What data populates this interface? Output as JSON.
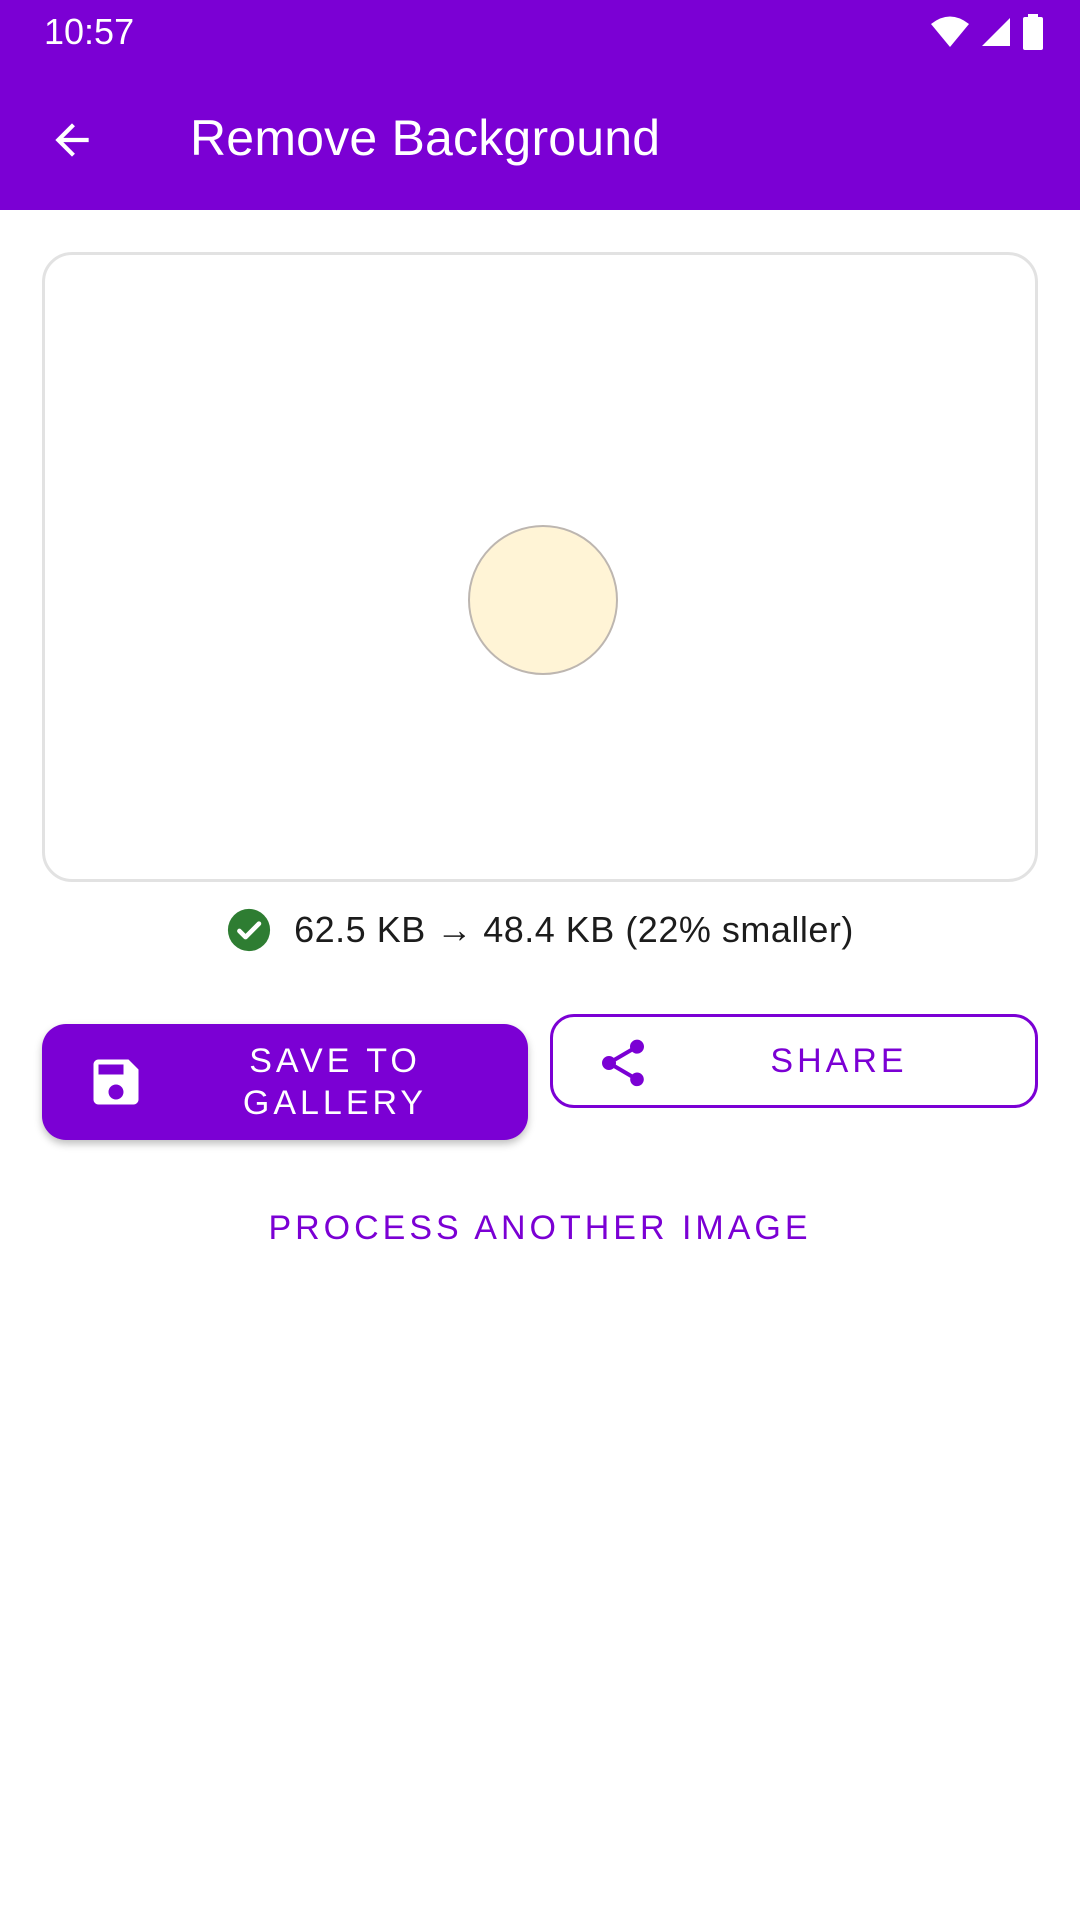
{
  "status_bar": {
    "time": "10:57",
    "icons": [
      "wifi-icon",
      "cell-signal-icon",
      "battery-icon"
    ]
  },
  "app_bar": {
    "title": "Remove Background",
    "back_icon": "arrow-back-icon"
  },
  "preview": {
    "image_fill": "#FFF4D6"
  },
  "result": {
    "icon": "check-circle-icon",
    "text": "62.5 KB → 48.4 KB (22% smaller)"
  },
  "actions": {
    "save_label": "SAVE TO GALLERY",
    "save_icon": "floppy-disk-icon",
    "share_label": "SHARE",
    "share_icon": "share-icon",
    "process_label": "PROCESS ANOTHER IMAGE"
  },
  "colors": {
    "primary": "#7B00D4",
    "success": "#2E7D32",
    "on_primary": "#FFFFFF"
  }
}
